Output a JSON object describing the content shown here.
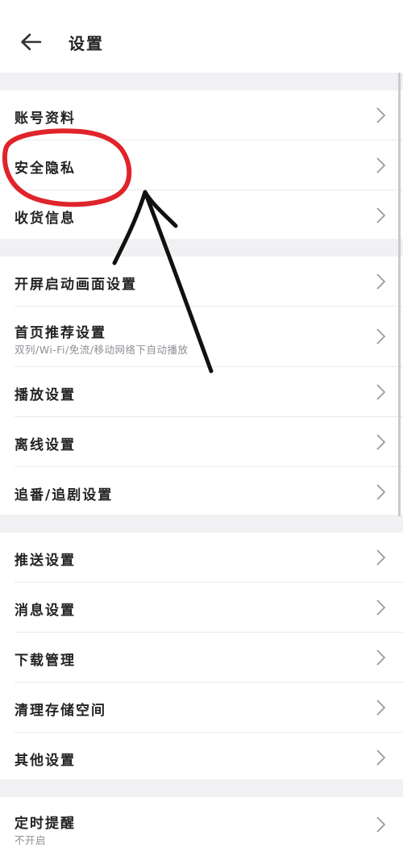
{
  "header": {
    "title": "设置",
    "back_icon": "arrow-left-icon"
  },
  "sections": [
    {
      "items": [
        {
          "label": "账号资料"
        },
        {
          "label": "安全隐私"
        },
        {
          "label": "收货信息"
        }
      ]
    },
    {
      "items": [
        {
          "label": "开屏启动画面设置"
        },
        {
          "label": "首页推荐设置",
          "sub": "双列/Wi-Fi/免流/移动网络下自动播放"
        },
        {
          "label": "播放设置"
        },
        {
          "label": "离线设置"
        },
        {
          "label": "追番/追剧设置"
        }
      ]
    },
    {
      "items": [
        {
          "label": "推送设置"
        },
        {
          "label": "消息设置"
        },
        {
          "label": "下载管理"
        },
        {
          "label": "清理存储空间"
        },
        {
          "label": "其他设置"
        }
      ]
    },
    {
      "items": [
        {
          "label": "定时提醒",
          "sub": "不开启"
        }
      ]
    }
  ],
  "colors": {
    "background": "#f1f1f3",
    "row_background": "#ffffff",
    "annotation_circle": "#e0242b",
    "annotation_arrow": "#111111"
  },
  "icons": {
    "row_chevron": "chevron-right-icon"
  }
}
